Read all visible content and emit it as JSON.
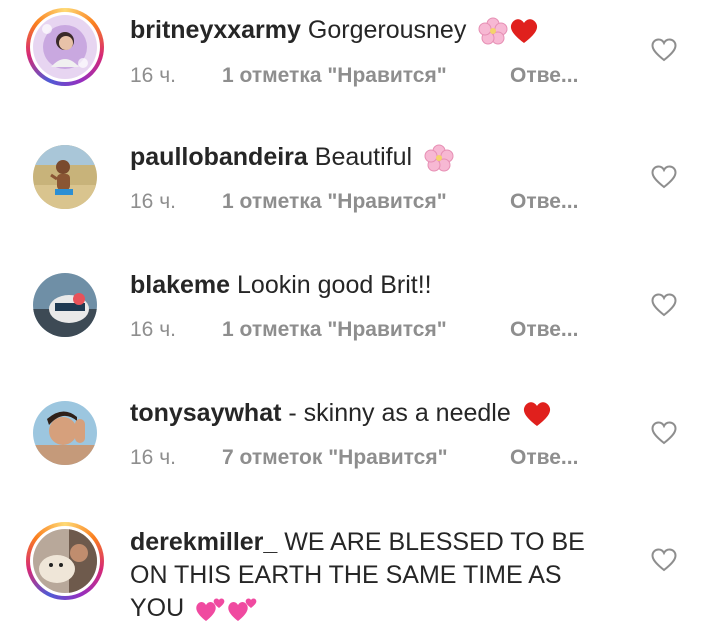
{
  "comments": [
    {
      "username": "britneyxxarmy",
      "text": "Gorgerousney",
      "emojis": [
        "cherry-blossom",
        "red-heart"
      ],
      "time": "16 ч.",
      "likes": "1 отметка \"Нравится\"",
      "reply": "Отве..."
    },
    {
      "username": "paullobandeira",
      "text": "Beautiful",
      "emojis": [
        "cherry-blossom"
      ],
      "time": "16 ч.",
      "likes": "1 отметка \"Нравится\"",
      "reply": "Отве..."
    },
    {
      "username": "blakeme",
      "text": "Lookin good Brit!!",
      "emojis": [],
      "time": "16 ч.",
      "likes": "1 отметка \"Нравится\"",
      "reply": "Отве..."
    },
    {
      "username": "tonysaywhat",
      "text": "- skinny as a needle",
      "emojis": [
        "red-heart"
      ],
      "time": "16 ч.",
      "likes": "7 отметок \"Нравится\"",
      "reply": "Отве..."
    },
    {
      "username": "derekmiller_",
      "text": "WE ARE BLESSED TO BE ON THIS EARTH THE SAME TIME AS YOU",
      "emojis": [
        "two-hearts",
        "two-hearts"
      ],
      "time": "",
      "likes": "",
      "reply": ""
    }
  ],
  "colors": {
    "text": "#262626",
    "meta": "#8e8e8e",
    "heart_outline": "#8e8e8e",
    "red_heart": "#e0201d",
    "pink_heart": "#f04aa0",
    "blossom": "#f7b8d3"
  },
  "icons": {
    "like": "heart-outline-icon"
  }
}
